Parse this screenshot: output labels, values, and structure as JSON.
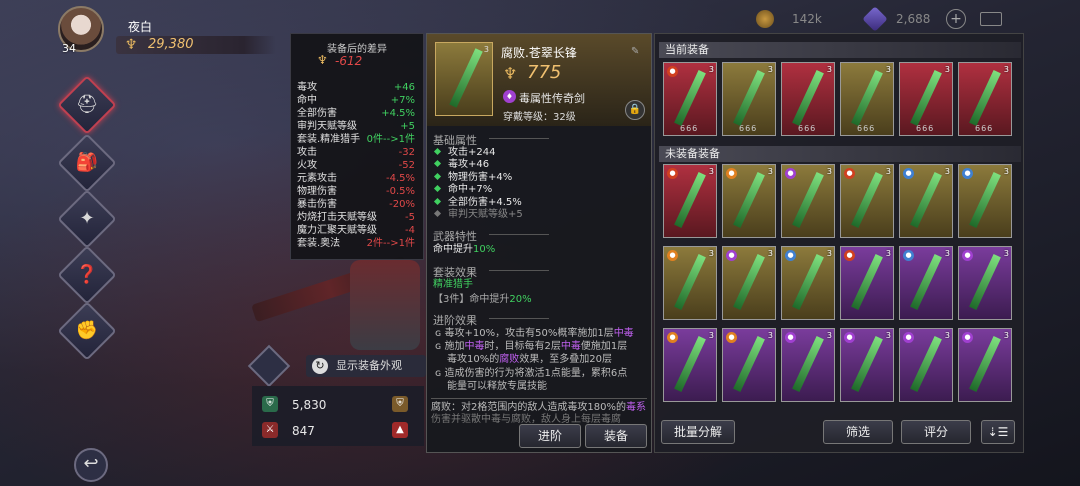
{
  "player": {
    "name": "夜白",
    "level": "34",
    "power": "29,380"
  },
  "resources": {
    "gold": "142k",
    "gems": "2,688"
  },
  "left_nav": [
    {
      "name": "nav-armor",
      "icon": "helmet-icon"
    },
    {
      "name": "nav-bag",
      "icon": "bag-icon"
    },
    {
      "name": "nav-skill",
      "icon": "skill-icon"
    },
    {
      "name": "nav-rune",
      "icon": "rune-icon"
    },
    {
      "name": "nav-pet",
      "icon": "pet-icon"
    }
  ],
  "show_appearance": "显示装备外观",
  "char_stats": {
    "hp": "5,830",
    "atk": "847"
  },
  "diff": {
    "title": "装备后的差异",
    "power_change": "-612",
    "rows": [
      {
        "k": "毒攻",
        "v": "+46",
        "up": true
      },
      {
        "k": "命中",
        "v": "+7%",
        "up": true
      },
      {
        "k": "全部伤害",
        "v": "+4.5%",
        "up": true
      },
      {
        "k": "审判天赋等级",
        "v": "+5",
        "up": true
      },
      {
        "k": "套装.精准猎手",
        "v": "0件-->1件",
        "up": true
      },
      {
        "k": "攻击",
        "v": "-32",
        "up": false
      },
      {
        "k": "火攻",
        "v": "-52",
        "up": false
      },
      {
        "k": "元素攻击",
        "v": "-4.5%",
        "up": false
      },
      {
        "k": "物理伤害",
        "v": "-0.5%",
        "up": false
      },
      {
        "k": "暴击伤害",
        "v": "-20%",
        "up": false
      },
      {
        "k": "灼烧打击天赋等级",
        "v": "-5",
        "up": false
      },
      {
        "k": "魔力汇聚天赋等级",
        "v": "-4",
        "up": false
      },
      {
        "k": "套装.奥法",
        "v": "2件-->1件",
        "up": false
      }
    ]
  },
  "item": {
    "name": "腐败.苍翠长锋",
    "power": "775",
    "type": "毒属性传奇剑",
    "req": "穿戴等级：32级",
    "tier": "3",
    "sec_basic": "基础属性",
    "basic": [
      "攻击+244",
      "毒攻+46",
      "物理伤害+4%",
      "命中+7%",
      "全部伤害+4.5%"
    ],
    "basic_gray": "审判天赋等级+5",
    "sec_weapon": "武器特性",
    "weapon_trait": "命中提升",
    "weapon_trait_val": "10%",
    "sec_set": "套装效果",
    "set_name": "精准猎手",
    "set_line": "【3件】命中提升",
    "set_line_val": "20%",
    "sec_adv": "进阶效果",
    "adv1a": "毒攻+10%，攻击有50%概率施加1层",
    "adv1b": "中毒",
    "adv2a": "施加",
    "adv2b": "中毒",
    "adv2c": "时，目标每有2层",
    "adv2d": "中毒",
    "adv2e": "便施加1层",
    "adv3a": "毒攻10%的",
    "adv3b": "腐败",
    "adv3c": "效果，至多叠加20层",
    "adv4": "造成伤害的行为将激活1点能量，累积6点",
    "adv5": "能量可以释放专属技能",
    "foot_a": "腐败：对2格范围内的敌人造成毒攻180%的",
    "foot_b": "毒系",
    "foot_c": "伤害并驱散中毒与腐败，敌人身上每层毒腐",
    "btn_advance": "进阶",
    "btn_equip": "装备"
  },
  "right": {
    "current_title": "当前装备",
    "unequipped_title": "未装备装备",
    "current": [
      {
        "bg": "red",
        "pc": "fire",
        "tag": "3",
        "stars": "666",
        "kind": "sword"
      },
      {
        "bg": "gold",
        "pc": "",
        "tag": "3",
        "stars": "666",
        "kind": "armor"
      },
      {
        "bg": "red",
        "pc": "",
        "tag": "3",
        "stars": "666",
        "kind": "helm"
      },
      {
        "bg": "gold",
        "pc": "",
        "tag": "3",
        "stars": "666",
        "kind": "boots"
      },
      {
        "bg": "red",
        "pc": "",
        "tag": "3",
        "stars": "666",
        "kind": "amulet"
      },
      {
        "bg": "red",
        "pc": "",
        "tag": "3",
        "stars": "666",
        "kind": "ring"
      }
    ],
    "rows": [
      [
        {
          "bg": "red",
          "pc": "fire"
        },
        {
          "bg": "gold",
          "pc": "light"
        },
        {
          "bg": "gold",
          "pc": "poison"
        },
        {
          "bg": "gold",
          "pc": "fire"
        },
        {
          "bg": "gold",
          "pc": "ice"
        },
        {
          "bg": "gold",
          "pc": "ice"
        }
      ],
      [
        {
          "bg": "gold",
          "pc": "light"
        },
        {
          "bg": "gold",
          "pc": "poison"
        },
        {
          "bg": "gold",
          "pc": "ice"
        },
        {
          "bg": "purp",
          "pc": "fire"
        },
        {
          "bg": "purp",
          "pc": "ice"
        },
        {
          "bg": "purp",
          "pc": "poison"
        }
      ],
      [
        {
          "bg": "purp",
          "pc": "light"
        },
        {
          "bg": "purp",
          "pc": "light"
        },
        {
          "bg": "purp",
          "pc": "poison"
        },
        {
          "bg": "purp",
          "pc": "poison"
        },
        {
          "bg": "purp",
          "pc": "poison"
        },
        {
          "bg": "purp",
          "pc": "poison"
        }
      ]
    ],
    "btn_batch": "批量分解",
    "btn_filter": "筛选",
    "btn_score": "评分"
  },
  "colors": {
    "accent_gold": "#f0c070",
    "up": "#40d060",
    "down": "#e04848",
    "poison": "#c060f0"
  }
}
